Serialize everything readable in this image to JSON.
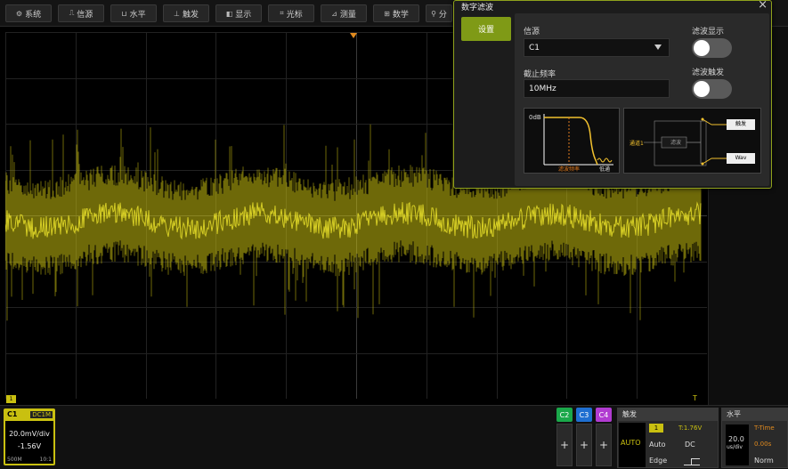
{
  "toolbar": {
    "buttons": [
      {
        "icon": "gear-icon",
        "glyph": "⚙",
        "label": "系统"
      },
      {
        "icon": "source-icon",
        "glyph": "⎍",
        "label": "信源"
      },
      {
        "icon": "horizontal-icon",
        "glyph": "⊔",
        "label": "水平"
      },
      {
        "icon": "trigger-icon",
        "glyph": "⊥",
        "label": "触发"
      },
      {
        "icon": "display-icon",
        "glyph": "◧",
        "label": "显示"
      },
      {
        "icon": "cursor-icon",
        "glyph": "⌗",
        "label": "光标"
      },
      {
        "icon": "measure-icon",
        "glyph": "⊿",
        "label": "测量"
      },
      {
        "icon": "math-icon",
        "glyph": "⊞",
        "label": "数学"
      },
      {
        "icon": "search-icon",
        "glyph": "⚲",
        "label": "分"
      }
    ]
  },
  "dialog": {
    "title": "数字滤波",
    "close": "×",
    "tab": "设置",
    "source_label": "信源",
    "source_value": "C1",
    "cutoff_label": "截止频率",
    "cutoff_value": "10MHz",
    "filter_display_label": "滤波显示",
    "filter_trigger_label": "滤波触发",
    "diagram": {
      "db_label": "0dB",
      "cutoff_text": "滤波频率",
      "lowpass_text": "低通",
      "channel_text": "通道1",
      "filter_box": "滤波",
      "trigger_out": "触发",
      "wave_out": "Wav"
    }
  },
  "channel1": {
    "name": "C1",
    "coupling": "DC1M",
    "scale": "20.0mV/div",
    "offset": "-1.56V",
    "bw": "500M",
    "ratio": "10:1"
  },
  "channels": [
    {
      "name": "C2",
      "color": "#1aa84a"
    },
    {
      "name": "C3",
      "color": "#1f6fd1"
    },
    {
      "name": "C4",
      "color": "#b13bd1"
    }
  ],
  "trigger": {
    "title": "触发",
    "source": "1",
    "level": "T:1.76V",
    "mode_big": "AUTO",
    "mode": "Auto",
    "coupling": "DC",
    "type": "Edge"
  },
  "horizontal": {
    "title": "水平",
    "timebase": "20.0",
    "timebase_unit": "us/div",
    "ttime_label": "T-Time",
    "ttime": "0.00s",
    "mode": "Norm"
  },
  "markers": {
    "ch1_level": "1",
    "trigger_pos": "T"
  },
  "colors": {
    "accent": "#8fa11c",
    "trace": "#c9c010",
    "ch1": "#c9c010"
  }
}
